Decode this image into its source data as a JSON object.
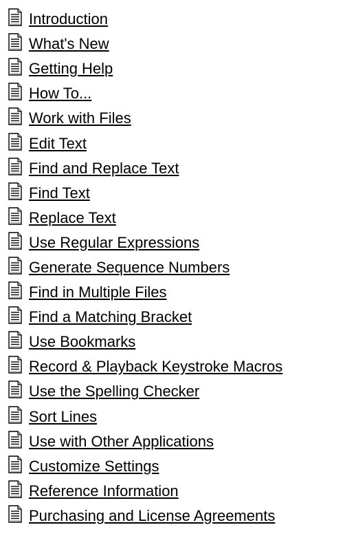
{
  "help_contents": {
    "topics": [
      {
        "label": "Introduction",
        "icon": "document-icon"
      },
      {
        "label": "What's New",
        "icon": "document-icon"
      },
      {
        "label": "Getting Help",
        "icon": "document-icon"
      },
      {
        "label": "How To...",
        "icon": "document-icon"
      },
      {
        "label": "Work with Files",
        "icon": "document-icon"
      },
      {
        "label": "Edit Text",
        "icon": "document-icon"
      },
      {
        "label": "Find and Replace Text",
        "icon": "document-icon"
      },
      {
        "label": "Find Text",
        "icon": "document-icon"
      },
      {
        "label": "Replace Text",
        "icon": "document-icon"
      },
      {
        "label": "Use Regular Expressions",
        "icon": "document-icon"
      },
      {
        "label": "Generate Sequence Numbers",
        "icon": "document-icon"
      },
      {
        "label": "Find in Multiple Files",
        "icon": "document-icon"
      },
      {
        "label": "Find a Matching Bracket",
        "icon": "document-icon"
      },
      {
        "label": "Use Bookmarks",
        "icon": "document-icon"
      },
      {
        "label": "Record & Playback Keystroke Macros",
        "icon": "document-icon"
      },
      {
        "label": "Use the Spelling Checker",
        "icon": "document-icon"
      },
      {
        "label": "Sort Lines",
        "icon": "document-icon"
      },
      {
        "label": "Use with Other Applications",
        "icon": "document-icon"
      },
      {
        "label": "Customize Settings",
        "icon": "document-icon"
      },
      {
        "label": "Reference Information",
        "icon": "document-icon"
      },
      {
        "label": "Purchasing and License Agreements",
        "icon": "document-icon"
      }
    ],
    "colors": {
      "background": "#ffffff",
      "link_text": "#000000",
      "icon_page": "#ffffff",
      "icon_fold": "#c0c0c0",
      "icon_outline": "#000000"
    }
  }
}
